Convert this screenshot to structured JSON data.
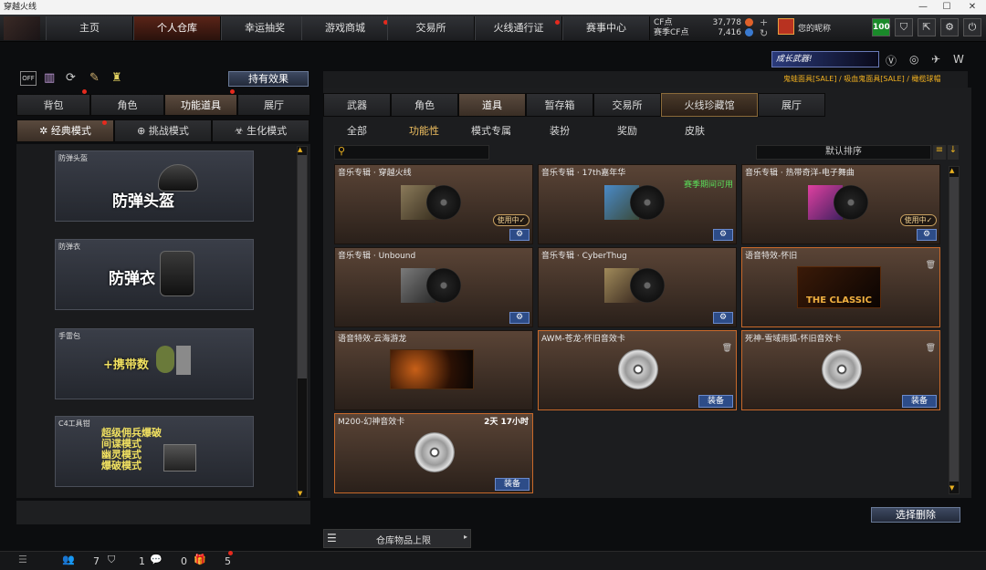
{
  "window": {
    "title": "穿越火线",
    "controls": [
      "—",
      "☐",
      "✕"
    ]
  },
  "topnav": {
    "tabs": [
      "主页",
      "个人仓库",
      "幸运抽奖",
      "游戏商城",
      "交易所",
      "火线通行证",
      "赛事中心"
    ],
    "cf_label": "CF点",
    "cf_value": "37,778",
    "season_cf_label": "赛季CF点",
    "season_cf_value": "7,416",
    "username": "您的昵称",
    "level": "100"
  },
  "left": {
    "effect_button": "持有效果",
    "tabs": [
      "背包",
      "角色",
      "功能道具",
      "展厅"
    ],
    "modes": [
      "经典模式",
      "挑战模式",
      "生化模式"
    ],
    "cards": [
      {
        "label": "防弹头盔",
        "name": "防弹头盔"
      },
      {
        "label": "防弹衣",
        "name": "防弹衣"
      },
      {
        "label": "手雷包",
        "name": "+携带数"
      },
      {
        "label": "C4工具钳",
        "name": "超级佣兵爆破\n间谍模式\n幽灵模式\n爆破模式",
        "lines": [
          "超级佣兵爆破",
          "间谍模式",
          "幽灵模式",
          "爆破模式"
        ]
      }
    ]
  },
  "right": {
    "banner_text": "成长武器!",
    "promo": "鬼蛙面具[SALE] / 吸血鬼面具[SALE] / 橄榄球帽",
    "tabs": [
      "武器",
      "角色",
      "道具",
      "暂存箱",
      "交易所",
      "火线珍藏馆",
      "展厅"
    ],
    "subtabs": [
      "全部",
      "功能性",
      "模式专属",
      "装扮",
      "奖励",
      "皮肤"
    ],
    "sort": "默认排序",
    "items": [
      {
        "name": "音乐专辑 · 穿越火线",
        "badge": "使用中✓",
        "type": "album"
      },
      {
        "name": "音乐专辑 · 17th嘉年华",
        "note": "赛季期间可用",
        "type": "album"
      },
      {
        "name": "音乐专辑 · 热带奇洋-电子舞曲",
        "badge": "使用中✓",
        "type": "album"
      },
      {
        "name": "音乐专辑 · Unbound",
        "type": "album"
      },
      {
        "name": "音乐专辑 · CyberThug",
        "type": "album"
      },
      {
        "name": "语音特效-怀旧",
        "cover_text": "THE CLASSIC",
        "type": "voice"
      },
      {
        "name": "语音特效-云海游龙",
        "type": "voice"
      },
      {
        "name": "AWM-苍龙-怀旧音效卡",
        "equip": "装备",
        "type": "card"
      },
      {
        "name": "死神-雪域雨狐-怀旧音效卡",
        "equip": "装备",
        "type": "card"
      },
      {
        "name": "M200-幻神音效卡",
        "time": "2天 17小时",
        "equip": "装备",
        "type": "card"
      }
    ],
    "delete_button": "选择删除",
    "storage_label": "仓库物品上限"
  },
  "bottom": {
    "counts": [
      "7",
      "1",
      "0",
      "5"
    ]
  }
}
